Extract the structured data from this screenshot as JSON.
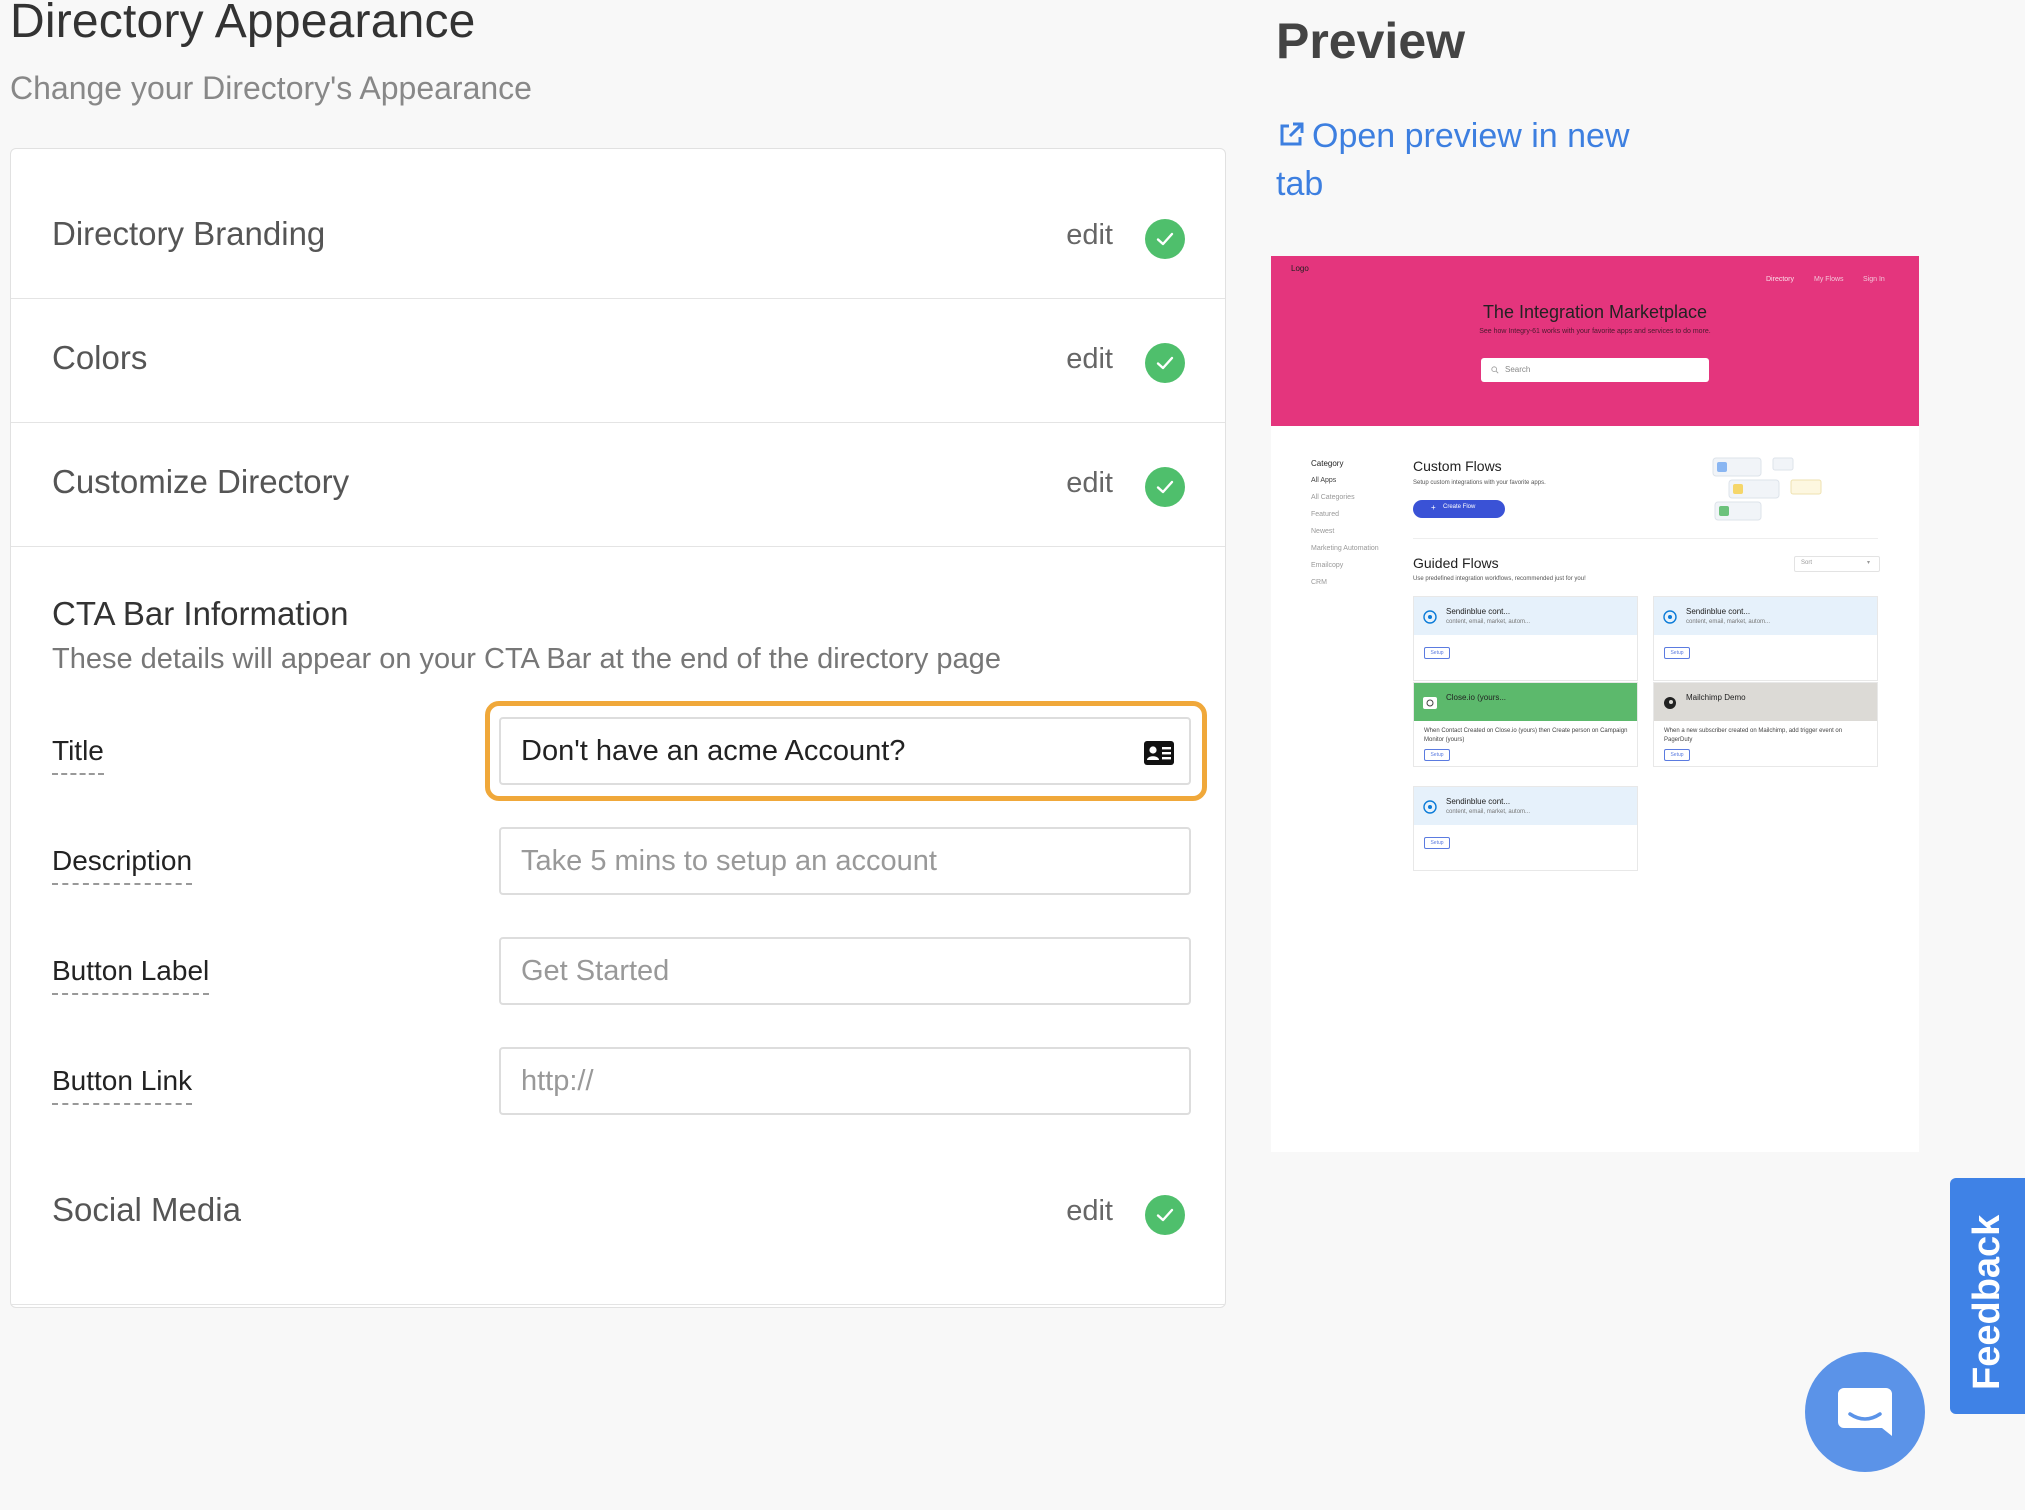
{
  "header": {
    "title": "Directory Appearance",
    "subtitle": "Change your Directory's Appearance"
  },
  "sections": {
    "branding": {
      "title": "Directory Branding",
      "edit": "edit",
      "complete": true
    },
    "colors": {
      "title": "Colors",
      "edit": "edit",
      "complete": true
    },
    "customize": {
      "title": "Customize Directory",
      "edit": "edit",
      "complete": true
    },
    "social": {
      "title": "Social Media",
      "edit": "edit",
      "complete": true
    }
  },
  "cta": {
    "heading": "CTA Bar Information",
    "description": "These details will appear on your CTA Bar at the end of the directory page",
    "fields": {
      "title": {
        "label": "Title",
        "value": "Don't have an acme Account?"
      },
      "description": {
        "label": "Description",
        "placeholder": "Take 5 mins to setup an account"
      },
      "button_label": {
        "label": "Button Label",
        "placeholder": "Get Started"
      },
      "button_link": {
        "label": "Button Link",
        "placeholder": "http://"
      }
    }
  },
  "preview": {
    "heading": "Preview",
    "open_link": "Open preview in new tab",
    "mini": {
      "logo_alt": "Logo",
      "nav": [
        "Directory",
        "My Flows",
        "Sign In"
      ],
      "hero_title": "The Integration Marketplace",
      "hero_subtitle": "See how Integry-61 works with your favorite apps and services to do more.",
      "search_placeholder": "Search",
      "category_heading": "Category",
      "categories": [
        "All Apps",
        "All Categories",
        "Featured",
        "Newest",
        "Marketing Automation",
        "Emailcopy",
        "CRM"
      ],
      "custom_flows_title": "Custom Flows",
      "custom_flows_sub": "Setup custom integrations with your favorite apps.",
      "create_flow_btn": "Create Flow",
      "guided_flows_title": "Guided Flows",
      "guided_flows_sub": "Use predefined integration workflows, recommended just for you!",
      "sort_label": "Sort",
      "cards": [
        {
          "name": "Sendinblue cont...",
          "meta": "content, email, market, autom...",
          "desc": "",
          "btn": "Setup"
        },
        {
          "name": "Sendinblue cont...",
          "meta": "content, email, market, autom...",
          "desc": "",
          "btn": "Setup"
        },
        {
          "name": "Close.io (yours...",
          "meta": "",
          "desc": "When Contact Created on Close.io (yours) then Create person on Campaign Monitor (yours)",
          "btn": "Setup"
        },
        {
          "name": "Mailchimp Demo",
          "meta": "",
          "desc": "When a new subscriber created on Mailchimp, add trigger event on PagerDuty",
          "btn": "Setup"
        },
        {
          "name": "Sendinblue cont...",
          "meta": "content, email, market, autom...",
          "desc": "",
          "btn": "Setup"
        }
      ],
      "colors": {
        "hero": "#e4357d",
        "primary_btn": "#3a52d6",
        "close_card": "#5cb96c",
        "mailchimp_card": "#dcdad6",
        "sendinblue_card": "#e6f1fb"
      }
    }
  },
  "feedback_label": "Feedback",
  "icons": {
    "check": "check-circle-icon",
    "external": "external-link-icon",
    "contact_card": "contact-card-icon",
    "chat": "chat-bubble-icon"
  },
  "colors": {
    "accent": "#3d7fe0",
    "success": "#4fbf6c",
    "focus": "#f0a83a",
    "feedback": "#3f82e6"
  }
}
